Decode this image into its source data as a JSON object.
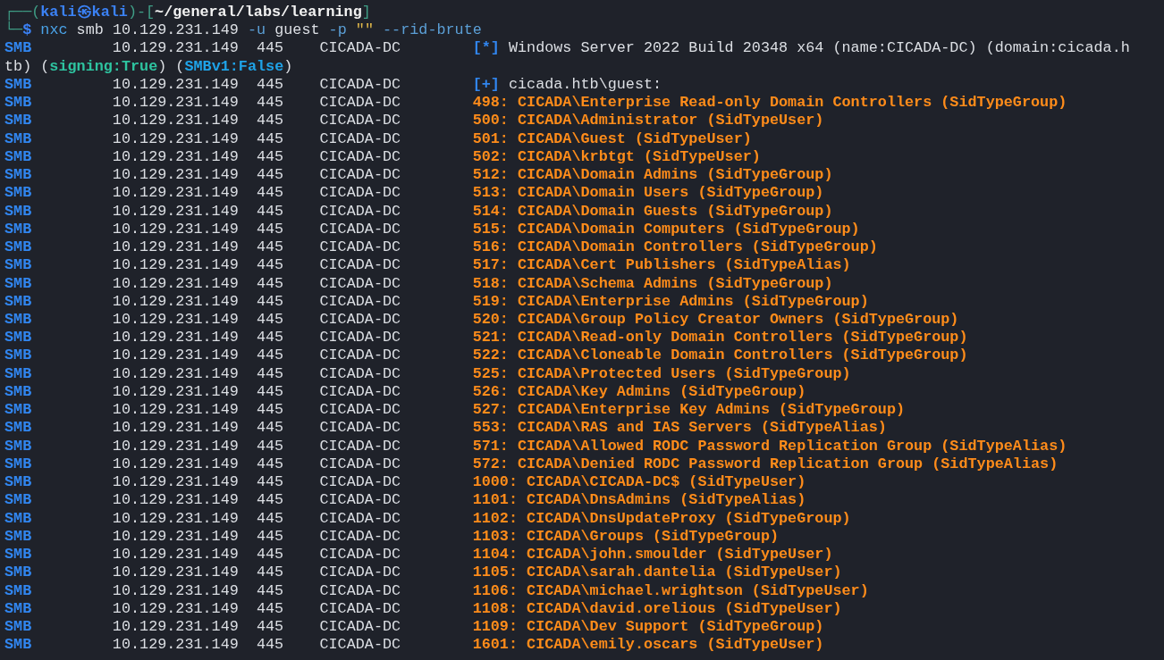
{
  "prompt": {
    "segments": [
      {
        "text": "┌──(",
        "kind": "frame"
      },
      {
        "text": "kali㉿kali",
        "kind": "user"
      },
      {
        "text": ")-[",
        "kind": "frame"
      },
      {
        "text": "~/general/labs/learning",
        "kind": "path"
      },
      {
        "text": "]",
        "kind": "frame"
      }
    ]
  },
  "command": {
    "segments": [
      {
        "text": "└─",
        "kind": "frame"
      },
      {
        "text": "$",
        "kind": "user"
      },
      {
        "text": " nxc",
        "kind": "cmd"
      },
      {
        "text": " smb 10.129.231.149",
        "kind": "plain"
      },
      {
        "text": " -u",
        "kind": "opt"
      },
      {
        "text": " guest",
        "kind": "plain"
      },
      {
        "text": " -p",
        "kind": "opt"
      },
      {
        "text": " \"\"",
        "kind": "string"
      },
      {
        "text": " --rid-brute",
        "kind": "opt"
      }
    ]
  },
  "lines": [
    {
      "protocol": "SMB",
      "host": "10.129.231.149",
      "port": "445",
      "name": "CICADA-DC",
      "marker": "[*]",
      "segments": [
        {
          "text": "Windows Server 2022 Build 20348 x64 (name:CICADA-DC) (domain:cicada.h",
          "kind": "plain"
        }
      ]
    },
    {
      "segments": [
        {
          "text": "tb) (",
          "kind": "plain"
        },
        {
          "text": "signing:True",
          "kind": "good"
        },
        {
          "text": ") (",
          "kind": "plain"
        },
        {
          "text": "SMBv1:False",
          "kind": "info"
        },
        {
          "text": ")",
          "kind": "plain"
        }
      ]
    },
    {
      "protocol": "SMB",
      "host": "10.129.231.149",
      "port": "445",
      "name": "CICADA-DC",
      "marker": "[+]",
      "segments": [
        {
          "text": "cicada.htb\\guest:",
          "kind": "plain"
        }
      ]
    },
    {
      "protocol": "SMB",
      "host": "10.129.231.149",
      "port": "445",
      "name": "CICADA-DC",
      "segments": [
        {
          "text": "498: CICADA\\Enterprise Read-only Domain Controllers (SidTypeGroup)",
          "kind": "found"
        }
      ]
    },
    {
      "protocol": "SMB",
      "host": "10.129.231.149",
      "port": "445",
      "name": "CICADA-DC",
      "segments": [
        {
          "text": "500: CICADA\\Administrator (SidTypeUser)",
          "kind": "found"
        }
      ]
    },
    {
      "protocol": "SMB",
      "host": "10.129.231.149",
      "port": "445",
      "name": "CICADA-DC",
      "segments": [
        {
          "text": "501: CICADA\\Guest (SidTypeUser)",
          "kind": "found"
        }
      ]
    },
    {
      "protocol": "SMB",
      "host": "10.129.231.149",
      "port": "445",
      "name": "CICADA-DC",
      "segments": [
        {
          "text": "502: CICADA\\krbtgt (SidTypeUser)",
          "kind": "found"
        }
      ]
    },
    {
      "protocol": "SMB",
      "host": "10.129.231.149",
      "port": "445",
      "name": "CICADA-DC",
      "segments": [
        {
          "text": "512: CICADA\\Domain Admins (SidTypeGroup)",
          "kind": "found"
        }
      ]
    },
    {
      "protocol": "SMB",
      "host": "10.129.231.149",
      "port": "445",
      "name": "CICADA-DC",
      "segments": [
        {
          "text": "513: CICADA\\Domain Users (SidTypeGroup)",
          "kind": "found"
        }
      ]
    },
    {
      "protocol": "SMB",
      "host": "10.129.231.149",
      "port": "445",
      "name": "CICADA-DC",
      "segments": [
        {
          "text": "514: CICADA\\Domain Guests (SidTypeGroup)",
          "kind": "found"
        }
      ]
    },
    {
      "protocol": "SMB",
      "host": "10.129.231.149",
      "port": "445",
      "name": "CICADA-DC",
      "segments": [
        {
          "text": "515: CICADA\\Domain Computers (SidTypeGroup)",
          "kind": "found"
        }
      ]
    },
    {
      "protocol": "SMB",
      "host": "10.129.231.149",
      "port": "445",
      "name": "CICADA-DC",
      "segments": [
        {
          "text": "516: CICADA\\Domain Controllers (SidTypeGroup)",
          "kind": "found"
        }
      ]
    },
    {
      "protocol": "SMB",
      "host": "10.129.231.149",
      "port": "445",
      "name": "CICADA-DC",
      "segments": [
        {
          "text": "517: CICADA\\Cert Publishers (SidTypeAlias)",
          "kind": "found"
        }
      ]
    },
    {
      "protocol": "SMB",
      "host": "10.129.231.149",
      "port": "445",
      "name": "CICADA-DC",
      "segments": [
        {
          "text": "518: CICADA\\Schema Admins (SidTypeGroup)",
          "kind": "found"
        }
      ]
    },
    {
      "protocol": "SMB",
      "host": "10.129.231.149",
      "port": "445",
      "name": "CICADA-DC",
      "segments": [
        {
          "text": "519: CICADA\\Enterprise Admins (SidTypeGroup)",
          "kind": "found"
        }
      ]
    },
    {
      "protocol": "SMB",
      "host": "10.129.231.149",
      "port": "445",
      "name": "CICADA-DC",
      "segments": [
        {
          "text": "520: CICADA\\Group Policy Creator Owners (SidTypeGroup)",
          "kind": "found"
        }
      ]
    },
    {
      "protocol": "SMB",
      "host": "10.129.231.149",
      "port": "445",
      "name": "CICADA-DC",
      "segments": [
        {
          "text": "521: CICADA\\Read-only Domain Controllers (SidTypeGroup)",
          "kind": "found"
        }
      ]
    },
    {
      "protocol": "SMB",
      "host": "10.129.231.149",
      "port": "445",
      "name": "CICADA-DC",
      "segments": [
        {
          "text": "522: CICADA\\Cloneable Domain Controllers (SidTypeGroup)",
          "kind": "found"
        }
      ]
    },
    {
      "protocol": "SMB",
      "host": "10.129.231.149",
      "port": "445",
      "name": "CICADA-DC",
      "segments": [
        {
          "text": "525: CICADA\\Protected Users (SidTypeGroup)",
          "kind": "found"
        }
      ]
    },
    {
      "protocol": "SMB",
      "host": "10.129.231.149",
      "port": "445",
      "name": "CICADA-DC",
      "segments": [
        {
          "text": "526: CICADA\\Key Admins (SidTypeGroup)",
          "kind": "found"
        }
      ]
    },
    {
      "protocol": "SMB",
      "host": "10.129.231.149",
      "port": "445",
      "name": "CICADA-DC",
      "segments": [
        {
          "text": "527: CICADA\\Enterprise Key Admins (SidTypeGroup)",
          "kind": "found"
        }
      ]
    },
    {
      "protocol": "SMB",
      "host": "10.129.231.149",
      "port": "445",
      "name": "CICADA-DC",
      "segments": [
        {
          "text": "553: CICADA\\RAS and IAS Servers (SidTypeAlias)",
          "kind": "found"
        }
      ]
    },
    {
      "protocol": "SMB",
      "host": "10.129.231.149",
      "port": "445",
      "name": "CICADA-DC",
      "segments": [
        {
          "text": "571: CICADA\\Allowed RODC Password Replication Group (SidTypeAlias)",
          "kind": "found"
        }
      ]
    },
    {
      "protocol": "SMB",
      "host": "10.129.231.149",
      "port": "445",
      "name": "CICADA-DC",
      "segments": [
        {
          "text": "572: CICADA\\Denied RODC Password Replication Group (SidTypeAlias)",
          "kind": "found"
        }
      ]
    },
    {
      "protocol": "SMB",
      "host": "10.129.231.149",
      "port": "445",
      "name": "CICADA-DC",
      "segments": [
        {
          "text": "1000: CICADA\\CICADA-DC$ (SidTypeUser)",
          "kind": "found"
        }
      ]
    },
    {
      "protocol": "SMB",
      "host": "10.129.231.149",
      "port": "445",
      "name": "CICADA-DC",
      "segments": [
        {
          "text": "1101: CICADA\\DnsAdmins (SidTypeAlias)",
          "kind": "found"
        }
      ]
    },
    {
      "protocol": "SMB",
      "host": "10.129.231.149",
      "port": "445",
      "name": "CICADA-DC",
      "segments": [
        {
          "text": "1102: CICADA\\DnsUpdateProxy (SidTypeGroup)",
          "kind": "found"
        }
      ]
    },
    {
      "protocol": "SMB",
      "host": "10.129.231.149",
      "port": "445",
      "name": "CICADA-DC",
      "segments": [
        {
          "text": "1103: CICADA\\Groups (SidTypeGroup)",
          "kind": "found"
        }
      ]
    },
    {
      "protocol": "SMB",
      "host": "10.129.231.149",
      "port": "445",
      "name": "CICADA-DC",
      "segments": [
        {
          "text": "1104: CICADA\\john.smoulder (SidTypeUser)",
          "kind": "found"
        }
      ]
    },
    {
      "protocol": "SMB",
      "host": "10.129.231.149",
      "port": "445",
      "name": "CICADA-DC",
      "segments": [
        {
          "text": "1105: CICADA\\sarah.dantelia (SidTypeUser)",
          "kind": "found"
        }
      ]
    },
    {
      "protocol": "SMB",
      "host": "10.129.231.149",
      "port": "445",
      "name": "CICADA-DC",
      "segments": [
        {
          "text": "1106: CICADA\\michael.wrightson (SidTypeUser)",
          "kind": "found"
        }
      ]
    },
    {
      "protocol": "SMB",
      "host": "10.129.231.149",
      "port": "445",
      "name": "CICADA-DC",
      "segments": [
        {
          "text": "1108: CICADA\\david.orelious (SidTypeUser)",
          "kind": "found"
        }
      ]
    },
    {
      "protocol": "SMB",
      "host": "10.129.231.149",
      "port": "445",
      "name": "CICADA-DC",
      "segments": [
        {
          "text": "1109: CICADA\\Dev Support (SidTypeGroup)",
          "kind": "found"
        }
      ]
    },
    {
      "protocol": "SMB",
      "host": "10.129.231.149",
      "port": "445",
      "name": "CICADA-DC",
      "segments": [
        {
          "text": "1601: CICADA\\emily.oscars (SidTypeUser)",
          "kind": "found"
        }
      ]
    }
  ]
}
